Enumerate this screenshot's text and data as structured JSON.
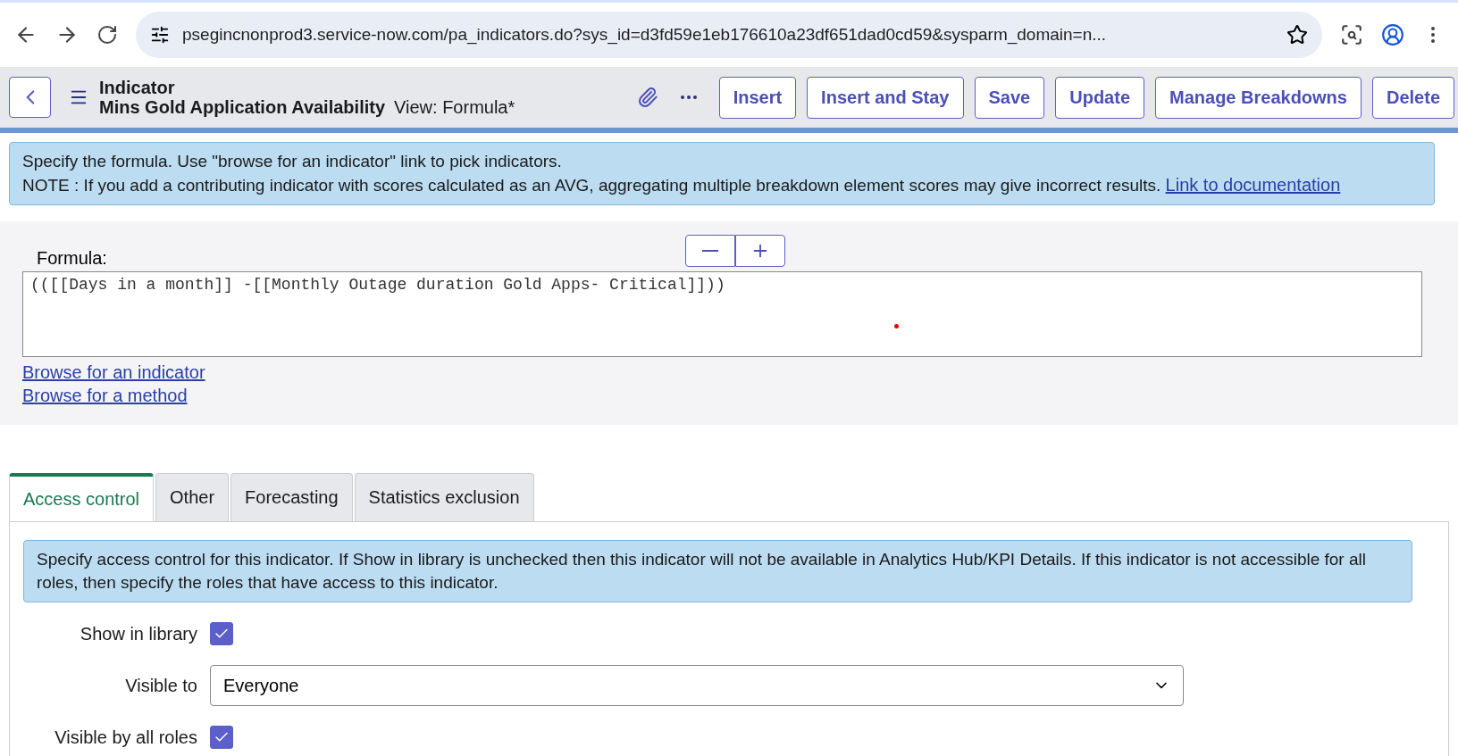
{
  "browser": {
    "url": "psegincnonprod3.service-now.com/pa_indicators.do?sys_id=d3fd59e1eb176610a23df651dad0cd59&sysparm_domain=n..."
  },
  "header": {
    "record_type": "Indicator",
    "record_name": "Mins Gold Application Availability",
    "view": "View: Formula*",
    "buttons": [
      "Insert",
      "Insert and Stay",
      "Save",
      "Update",
      "Manage Breakdowns",
      "Delete"
    ]
  },
  "formula_note": {
    "line1": "Specify the formula. Use \"browse for an indicator\" link to pick indicators.",
    "line2": "NOTE : If you add a contributing indicator with scores calculated as an AVG, aggregating multiple breakdown element scores may give incorrect results.",
    "link": "Link to documentation"
  },
  "formula": {
    "label": "Formula:",
    "value": "(([[Days in a month]] -[[Monthly Outage duration Gold Apps- Critical]]))",
    "links": [
      "Browse for an indicator",
      "Browse for a method"
    ]
  },
  "tabs": [
    {
      "label": "Access control",
      "selected": true
    },
    {
      "label": "Other",
      "selected": false
    },
    {
      "label": "Forecasting",
      "selected": false
    },
    {
      "label": "Statistics exclusion",
      "selected": false
    }
  ],
  "access_note": "Specify access control for this indicator. If Show in library is unchecked then this indicator will not be available in Analytics Hub/KPI Details. If this indicator is not accessible for all roles, then specify the roles that have access to this indicator.",
  "fields": [
    {
      "kind": "checkbox",
      "label": "Show in library",
      "checked": true
    },
    {
      "kind": "select",
      "label": "Visible to",
      "value": "Everyone"
    },
    {
      "kind": "checkbox",
      "label": "Visible by all roles",
      "checked": true
    }
  ]
}
